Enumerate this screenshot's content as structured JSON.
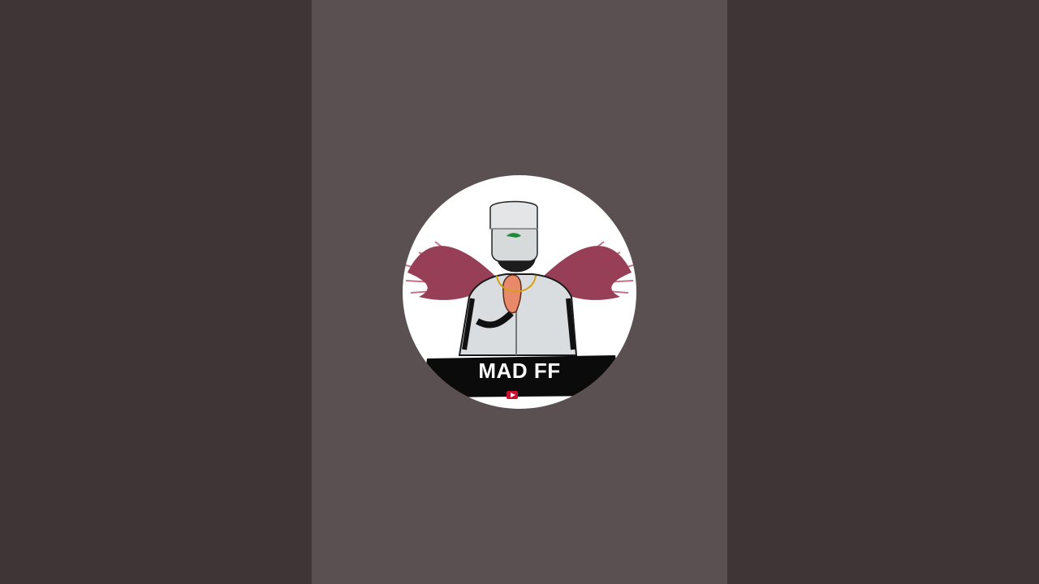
{
  "channel": {
    "name": "MAD FF"
  },
  "colors": {
    "side_background": "#3f3537",
    "center_background": "#5a5052",
    "wing_color": "#8b2a44",
    "banner_color": "#0b0b0b",
    "logo_accent": "#c8102e"
  },
  "icons": {
    "avatar": "masked-character-with-wings",
    "cap_logo": "crocodile-logo-icon",
    "badge": "youtube-style-badge-icon"
  }
}
